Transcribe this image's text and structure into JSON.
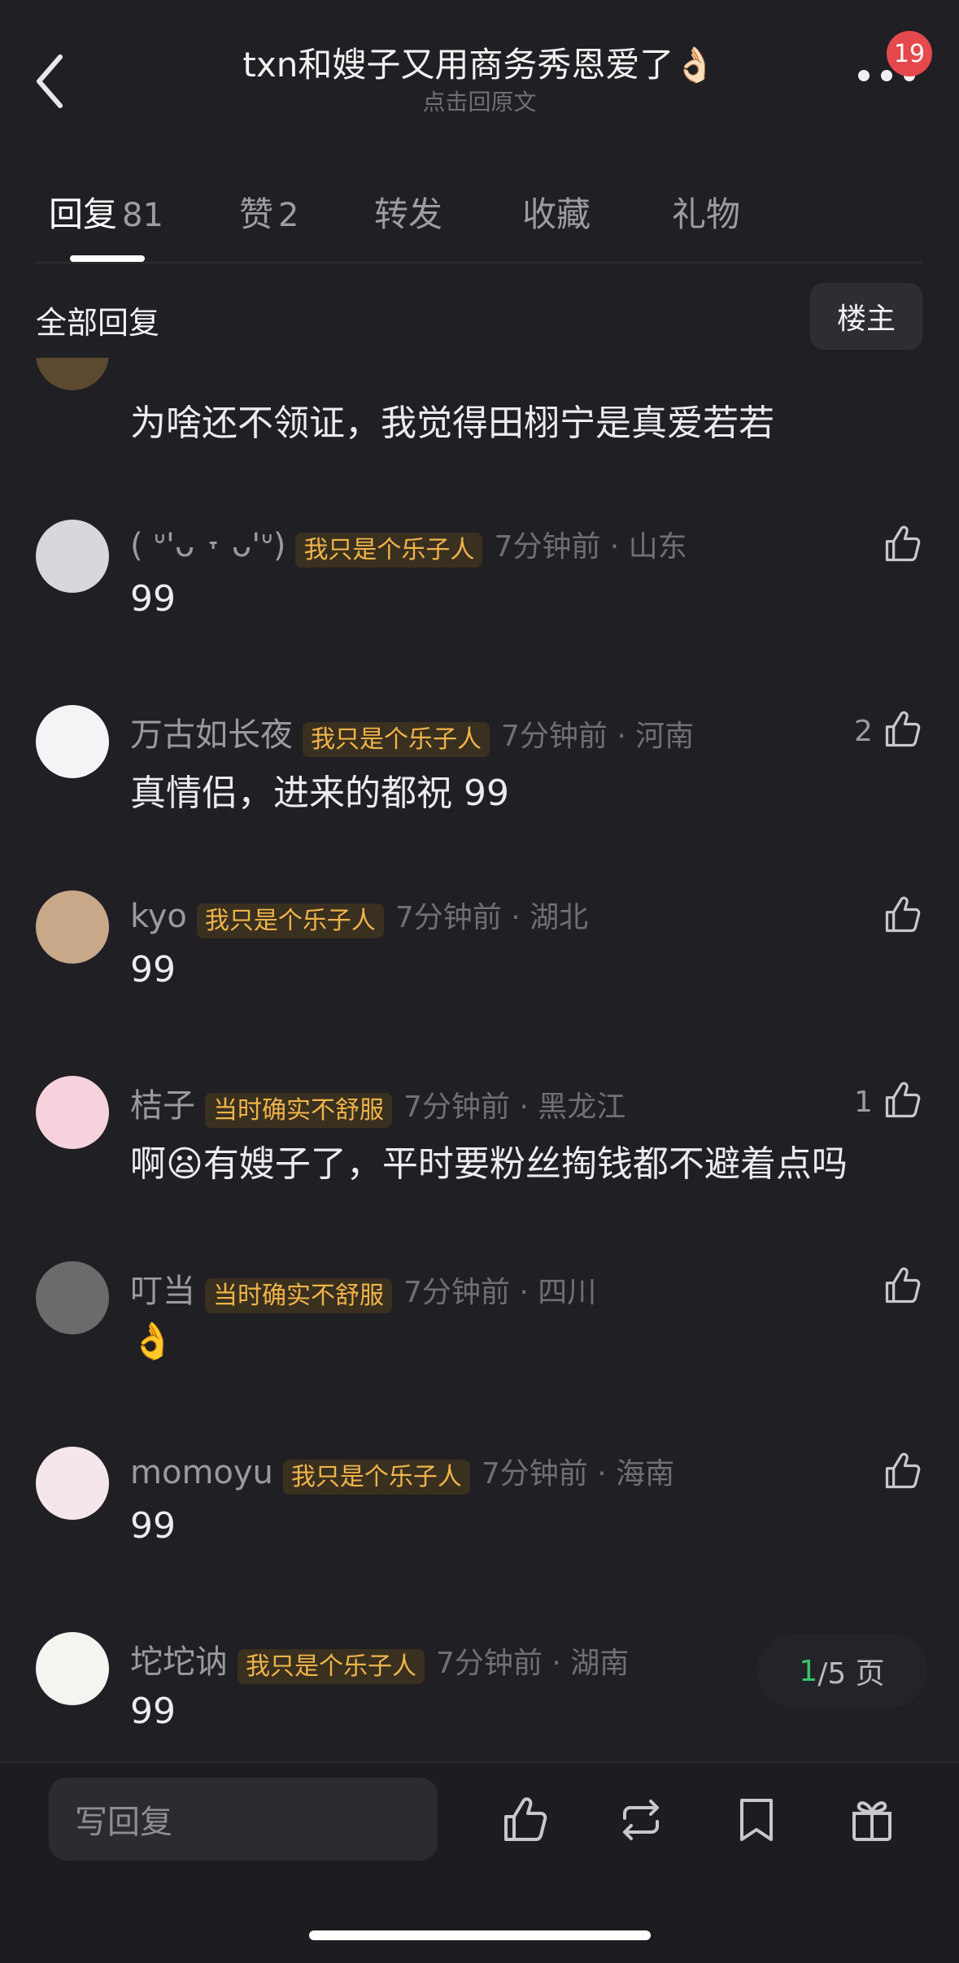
{
  "header": {
    "title": "txn和嫂子又用商务秀恩爱了👌🏻",
    "subtitle": "点击回原文",
    "notification_count": "19"
  },
  "tabs": [
    {
      "label": "回复",
      "count": "81"
    },
    {
      "label": "赞",
      "count": "2"
    },
    {
      "label": "转发",
      "count": ""
    },
    {
      "label": "收藏",
      "count": ""
    },
    {
      "label": "礼物",
      "count": ""
    }
  ],
  "filter": {
    "all_replies": "全部回复",
    "op_only": "楼主"
  },
  "partial_comment": {
    "text": "为啥还不领证，我觉得田栩宁是真爱若若"
  },
  "comments": [
    {
      "name": "( ᐡ'ᴗ ˕ ᴗ'ᐡ)",
      "tag": "我只是个乐子人",
      "time": "7分钟前 · 山东",
      "text": "99",
      "likes": ""
    },
    {
      "name": "万古如长夜",
      "tag": "我只是个乐子人",
      "time": "7分钟前 · 河南",
      "text": "真情侣，进来的都祝 99",
      "likes": "2"
    },
    {
      "name": "kyo",
      "tag": "我只是个乐子人",
      "time": "7分钟前 · 湖北",
      "text": "99",
      "likes": ""
    },
    {
      "name": "桔子",
      "tag": "当时确实不舒服",
      "time": "7分钟前 · 黑龙江",
      "text": "啊😦有嫂子了，平时要粉丝掏钱都不避着点吗",
      "likes": "1"
    },
    {
      "name": "叮当",
      "tag": "当时确实不舒服",
      "time": "7分钟前 · 四川",
      "text": "👌",
      "likes": ""
    },
    {
      "name": "momoyu",
      "tag": "我只是个乐子人",
      "time": "7分钟前 · 海南",
      "text": "99",
      "likes": ""
    },
    {
      "name": "坨坨讷",
      "tag": "我只是个乐子人",
      "time": "7分钟前 · 湖南",
      "text": "99",
      "likes": ""
    }
  ],
  "pager": {
    "current": "1",
    "rest": "/5 页"
  },
  "bottom_bar": {
    "reply_placeholder": "写回复"
  },
  "colors": {
    "background": "#1f1f24",
    "tag_text": "#f0b449",
    "badge": "#e5484d",
    "pager_current": "#39c46a"
  }
}
